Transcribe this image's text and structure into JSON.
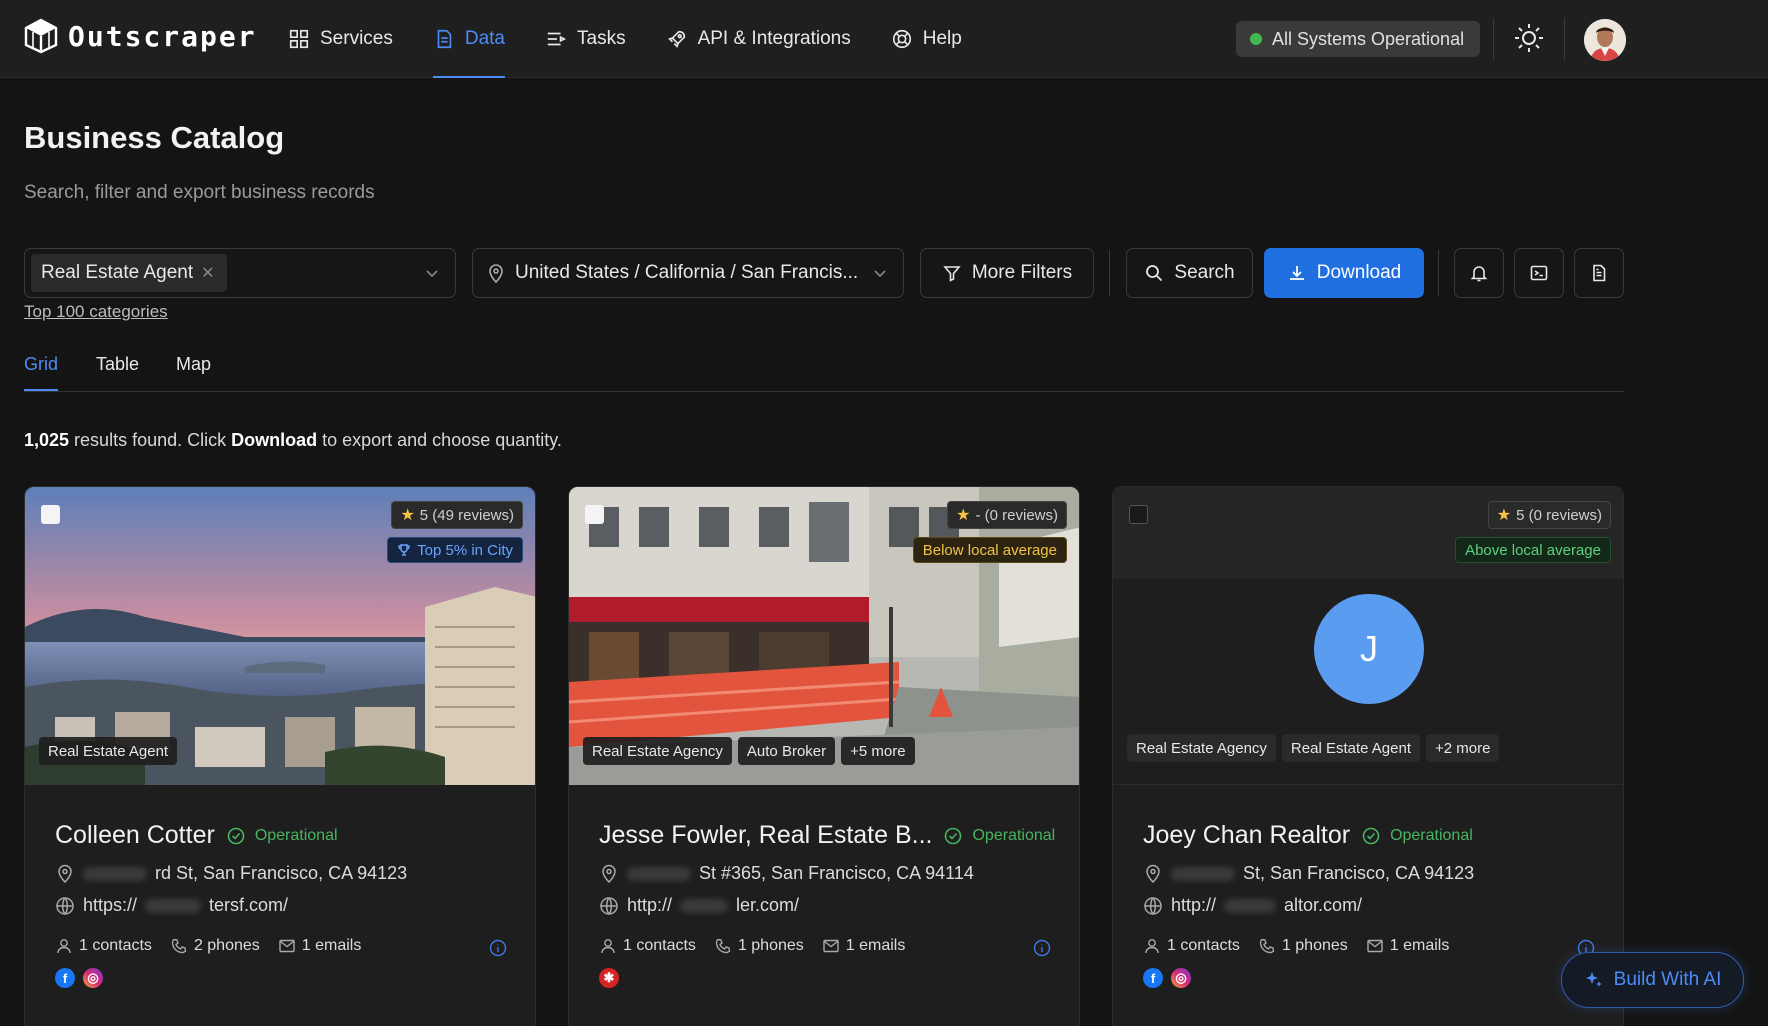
{
  "app": {
    "name": "Outscraper"
  },
  "nav": [
    {
      "label": "Services",
      "icon": "grid-icon"
    },
    {
      "label": "Data",
      "icon": "document-icon",
      "active": true
    },
    {
      "label": "Tasks",
      "icon": "tasks-icon"
    },
    {
      "label": "API & Integrations",
      "icon": "rocket-icon"
    },
    {
      "label": "Help",
      "icon": "lifebuoy-icon"
    }
  ],
  "status": {
    "label": "All Systems Operational",
    "color": "#3fb950"
  },
  "header": {
    "title": "Business Catalog",
    "subtitle": "Search, filter and export business records"
  },
  "filters": {
    "category_chip": "Real Estate Agent",
    "location": "United States / California / San Francis...",
    "more_filters_label": "More Filters",
    "search_label": "Search",
    "download_label": "Download",
    "top_categories_link": "Top 100 categories"
  },
  "tabs": [
    {
      "label": "Grid",
      "active": true
    },
    {
      "label": "Table"
    },
    {
      "label": "Map"
    }
  ],
  "results": {
    "count": "1,025",
    "text_before": " results found. Click ",
    "download_word": "Download",
    "text_after": " to export and choose quantity."
  },
  "cards": [
    {
      "rating": "5 (49 reviews)",
      "badge": "Top 5% in City",
      "tags": [
        "Real Estate Agent"
      ],
      "name": "Colleen Cotter",
      "status": "Operational",
      "address_visible": "rd St, San Francisco, CA 94123",
      "website_prefix": "https://",
      "website_suffix": "tersf.com/",
      "contacts": "1 contacts",
      "phones": "2 phones",
      "emails": "1 emails",
      "socials": [
        "facebook-icon",
        "instagram-icon"
      ]
    },
    {
      "rating": "- (0 reviews)",
      "badge": "Below local average",
      "tags": [
        "Real Estate Agency",
        "Auto Broker",
        "+5 more"
      ],
      "name": "Jesse Fowler, Real Estate B...",
      "status": "Operational",
      "address_visible": "St #365, San Francisco, CA 94114",
      "website_prefix": "http://",
      "website_suffix": "ler.com/",
      "contacts": "1 contacts",
      "phones": "1 phones",
      "emails": "1 emails",
      "socials": [
        "yelp-icon"
      ]
    },
    {
      "rating": "5 (0 reviews)",
      "badge": "Above local average",
      "avatar_letter": "J",
      "tags": [
        "Real Estate Agency",
        "Real Estate Agent",
        "+2 more"
      ],
      "name": "Joey Chan Realtor",
      "status": "Operational",
      "address_visible": "St, San Francisco, CA 94123",
      "website_prefix": "http://",
      "website_suffix": "altor.com/",
      "contacts": "1 contacts",
      "phones": "1 phones",
      "emails": "1 emails",
      "socials": [
        "facebook-icon",
        "instagram-icon"
      ]
    }
  ],
  "build_ai": {
    "label": "Build With AI"
  }
}
